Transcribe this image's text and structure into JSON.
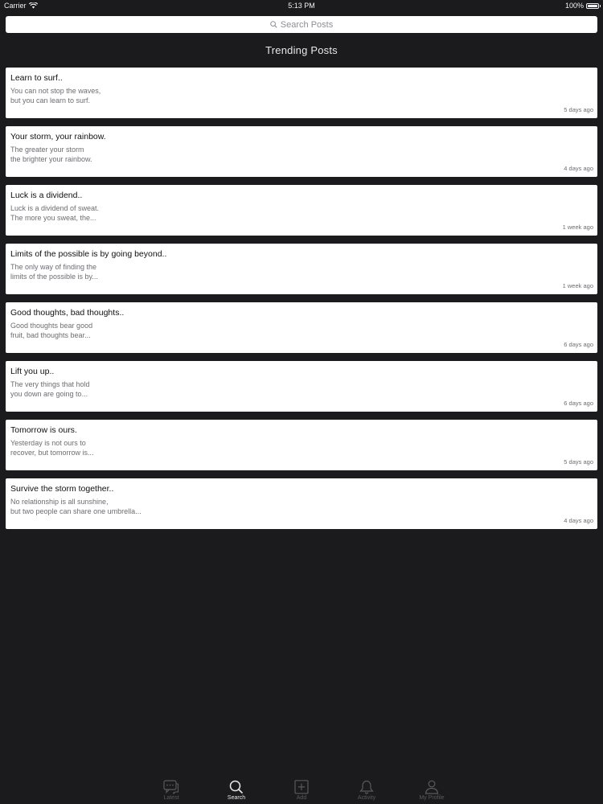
{
  "status_bar": {
    "carrier": "Carrier",
    "time": "5:13 PM",
    "battery": "100%"
  },
  "search": {
    "placeholder": "Search Posts"
  },
  "section_title": "Trending Posts",
  "posts": [
    {
      "title": "Learn to surf..",
      "excerpt": "You can not stop the waves,\nbut you can learn to surf.",
      "time": "5 days ago"
    },
    {
      "title": "Your storm, your rainbow.",
      "excerpt": "The greater your storm\nthe brighter your rainbow.",
      "time": "4 days ago"
    },
    {
      "title": "Luck is a dividend..",
      "excerpt": "Luck is a dividend of sweat.\nThe more you sweat, the...",
      "time": "1 week ago"
    },
    {
      "title": "Limits of the possible is by going beyond..",
      "excerpt": "The only way of finding the\nlimits of the possible is by...",
      "time": "1 week ago"
    },
    {
      "title": "Good thoughts, bad thoughts..",
      "excerpt": "Good thoughts bear good\nfruit, bad thoughts bear...",
      "time": "6 days ago"
    },
    {
      "title": "Lift you up..",
      "excerpt": "The very things that hold\nyou down are going to...",
      "time": "6 days ago"
    },
    {
      "title": "Tomorrow is ours.",
      "excerpt": "Yesterday is not ours to\nrecover,  but tomorrow is...",
      "time": "5 days ago"
    },
    {
      "title": "Survive the storm together..",
      "excerpt": "No relationship is all sunshine,\nbut two people can share one umbrella...",
      "time": "4 days ago"
    }
  ],
  "tab_bar": {
    "active": "Search",
    "tabs": [
      {
        "label": "Latest",
        "icon": "chat-bubbles-icon"
      },
      {
        "label": "Search",
        "icon": "search-icon"
      },
      {
        "label": "Add",
        "icon": "plus-square-icon"
      },
      {
        "label": "Activity",
        "icon": "bell-icon"
      },
      {
        "label": "My Profile",
        "icon": "person-icon"
      }
    ]
  },
  "colors": {
    "background": "#1b1b1d",
    "card": "#ffffff",
    "active_tab": "#e8e8e8",
    "inactive_tab": "#5a5a5e"
  }
}
